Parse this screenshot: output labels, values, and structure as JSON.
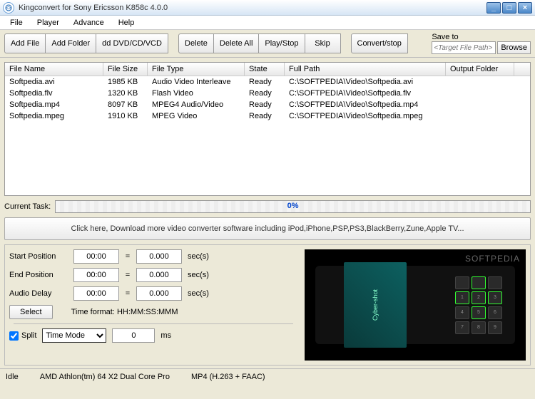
{
  "window": {
    "title": "Kingconvert for Sony Ericsson K858c 4.0.0"
  },
  "menu": {
    "file": "File",
    "player": "Player",
    "advance": "Advance",
    "help": "Help"
  },
  "toolbar": {
    "add_file": "Add File",
    "add_folder": "Add Folder",
    "add_dvd": "dd DVD/CD/VCD",
    "delete": "Delete",
    "delete_all": "Delete All",
    "play_stop": "Play/Stop",
    "skip": "Skip",
    "convert_stop": "Convert/stop"
  },
  "saveto": {
    "label": "Save to",
    "placeholder": "<Target File Path>",
    "browse": "Browse"
  },
  "columns": {
    "name": "File Name",
    "size": "File Size",
    "type": "File Type",
    "state": "State",
    "path": "Full Path",
    "out": "Output Folder"
  },
  "files": [
    {
      "name": "Softpedia.avi",
      "size": "1985 KB",
      "type": "Audio Video Interleave",
      "state": "Ready",
      "path": "C:\\SOFTPEDIA\\Video\\Softpedia.avi"
    },
    {
      "name": "Softpedia.flv",
      "size": "1320 KB",
      "type": "Flash Video",
      "state": "Ready",
      "path": "C:\\SOFTPEDIA\\Video\\Softpedia.flv"
    },
    {
      "name": "Softpedia.mp4",
      "size": "8097 KB",
      "type": "MPEG4 Audio/Video",
      "state": "Ready",
      "path": "C:\\SOFTPEDIA\\Video\\Softpedia.mp4"
    },
    {
      "name": "Softpedia.mpeg",
      "size": "1910 KB",
      "type": "MPEG Video",
      "state": "Ready",
      "path": "C:\\SOFTPEDIA\\Video\\Softpedia.mpeg"
    }
  ],
  "task": {
    "label": "Current Task:",
    "pct": "0%"
  },
  "promo": "Click here, Download more video converter software including iPod,iPhone,PSP,PS3,BlackBerry,Zune,Apple TV...",
  "pos": {
    "start_label": "Start Position",
    "end_label": "End Position",
    "audio_label": "Audio Delay",
    "start_t": "00:00",
    "start_s": "0.000",
    "end_t": "00:00",
    "end_s": "0.000",
    "audio_t": "00:00",
    "audio_s": "0.000",
    "unit": "sec(s)",
    "eq": "=",
    "select": "Select",
    "timefmt": "Time format: HH:MM:SS:MMM"
  },
  "split": {
    "label": "Split",
    "mode": "Time Mode",
    "value": "0",
    "unit": "ms"
  },
  "preview": {
    "watermark": "SOFTPEDIA",
    "screen": "Cyber-shot"
  },
  "status": {
    "idle": "Idle",
    "cpu": "AMD Athlon(tm) 64 X2 Dual Core Pro",
    "fmt": "MP4 (H.263 + FAAC)"
  }
}
